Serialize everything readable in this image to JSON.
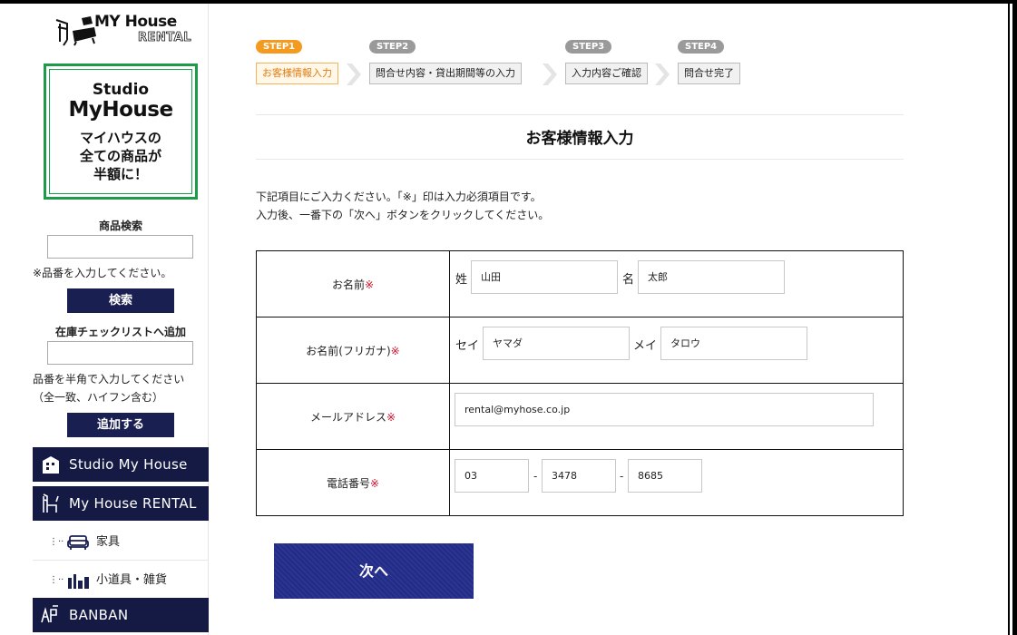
{
  "brand": {
    "logo_line1": "MY House",
    "logo_line2": "RENTAL"
  },
  "banner": {
    "line1": "Studio",
    "line2": "MyHouse",
    "line3a": "マイハウスの",
    "line3b": "全ての商品が",
    "line3c": "半額に！",
    "border_color": "#1e9a4b"
  },
  "sidebar": {
    "search_label": "商品検索",
    "search_value": "",
    "search_note": "※品番を入力してください。",
    "search_button": "検索",
    "stock_label": "在庫チェックリストへ追加",
    "stock_value": "",
    "stock_note1": "品番を半角で入力してください",
    "stock_note2": "（全一致、ハイフン含む）",
    "stock_button": "追加する",
    "nav": [
      {
        "label": "Studio My House",
        "icon": "building-icon"
      },
      {
        "label": "My House RENTAL",
        "icon": "chair-icon"
      },
      {
        "label": "家具",
        "icon": "sofa-icon"
      },
      {
        "label": "小道具・雑貨",
        "icon": "props-icon"
      },
      {
        "label": "BANBAN",
        "icon": "banban-icon"
      }
    ],
    "nav_color": "#151a44"
  },
  "steps": [
    {
      "pill": "STEP1",
      "label": "お客様情報入力",
      "active": true
    },
    {
      "pill": "STEP2",
      "label": "問合せ内容・貸出期間等の入力",
      "active": false
    },
    {
      "pill": "STEP3",
      "label": "入力内容ご確認",
      "active": false
    },
    {
      "pill": "STEP4",
      "label": "問合せ完了",
      "active": false
    }
  ],
  "page": {
    "title": "お客様情報入力",
    "intro1": "下記項目にご入力ください。「※」印は入力必須項目です。",
    "intro2": "入力後、一番下の「次へ」ボタンをクリックしてください。",
    "required_mark": "※",
    "accent_orange": "#f39a1f",
    "required_red": "#d0112b"
  },
  "form": {
    "name_label": "お名前",
    "name_sei_prefix": "姓",
    "name_sei_value": "山田",
    "name_mei_prefix": "名",
    "name_mei_value": "太郎",
    "kana_label": "お名前(フリガナ)",
    "kana_sei_prefix": "セイ",
    "kana_sei_value": "ヤマダ",
    "kana_mei_prefix": "メイ",
    "kana_mei_value": "タロウ",
    "email_label": "メールアドレス",
    "email_value": "rental@myhose.co.jp",
    "phone_label": "電話番号",
    "phone1": "03",
    "phone2": "3478",
    "phone3": "8685",
    "phone_sep": "-"
  },
  "next_button": "次へ",
  "next_button_color": "#222b88"
}
